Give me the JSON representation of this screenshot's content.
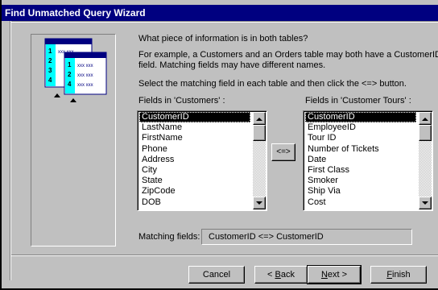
{
  "window": {
    "title": "Find Unmatched Query Wizard"
  },
  "instructions": {
    "question": "What piece of information is in both tables?",
    "example_line1": "For example, a Customers and an Orders table may both have a CustomerID",
    "example_line2": "field. Matching fields may have different names.",
    "select_line": "Select the matching field in each table and then click the <=> button."
  },
  "graphic": {
    "back_card_numbers": [
      "1",
      "2",
      "3",
      "4"
    ],
    "front_card_numbers": [
      "1",
      "2",
      "4"
    ],
    "row_text": "xxx xxx",
    "accent": "#00ffff"
  },
  "left_list": {
    "label": "Fields in 'Customers' :",
    "items": [
      "CustomerID",
      "LastName",
      "FirstName",
      "Phone",
      "Address",
      "City",
      "State",
      "ZipCode",
      "DOB"
    ],
    "selected": "CustomerID"
  },
  "right_list": {
    "label": "Fields in 'Customer Tours' :",
    "items": [
      "CustomerID",
      "EmployeeID",
      "Tour ID",
      "Number of Tickets",
      "Date",
      "First Class",
      "Smoker",
      "Ship Via",
      "Cost"
    ],
    "selected": "CustomerID"
  },
  "match_button": {
    "label": "<=>"
  },
  "matching": {
    "label": "Matching fields:",
    "value": "CustomerID <=> CustomerID"
  },
  "buttons": {
    "cancel": "Cancel",
    "back_prefix": "< ",
    "back_key": "B",
    "back_rest": "ack",
    "next_key": "N",
    "next_rest": "ext >",
    "finish_key": "F",
    "finish_rest": "inish"
  },
  "colors": {
    "titlebar": "#000080",
    "face": "#c0c0c0",
    "selection": "#000000"
  }
}
